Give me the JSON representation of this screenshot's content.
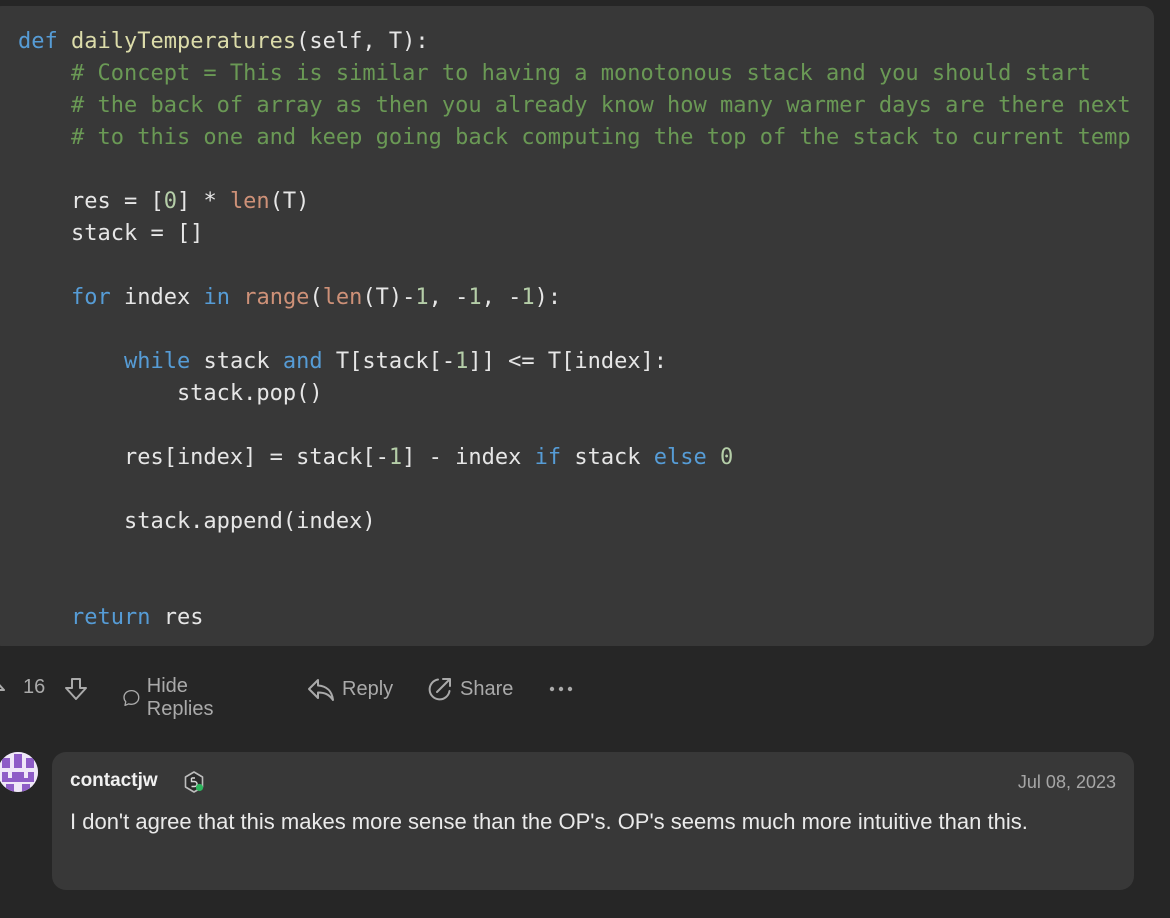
{
  "code": {
    "lines": [
      [
        {
          "t": "def ",
          "c": "kw"
        },
        {
          "t": "dailyTemperatures",
          "c": "fn"
        },
        {
          "t": "(self, T):",
          "c": ""
        }
      ],
      [
        {
          "t": "    # Concept = This is similar to having a monotonous stack and you should start",
          "c": "cm"
        }
      ],
      [
        {
          "t": "    # the back of array as then you already know how many warmer days are there next",
          "c": "cm"
        }
      ],
      [
        {
          "t": "    # to this one and keep going back computing the top of the stack to current temp",
          "c": "cm"
        }
      ],
      [
        {
          "t": "",
          "c": ""
        }
      ],
      [
        {
          "t": "    res = [",
          "c": ""
        },
        {
          "t": "0",
          "c": "nm"
        },
        {
          "t": "] * ",
          "c": ""
        },
        {
          "t": "len",
          "c": "bi"
        },
        {
          "t": "(T)",
          "c": ""
        }
      ],
      [
        {
          "t": "    stack = []",
          "c": ""
        }
      ],
      [
        {
          "t": "",
          "c": ""
        }
      ],
      [
        {
          "t": "    ",
          "c": ""
        },
        {
          "t": "for",
          "c": "kw"
        },
        {
          "t": " index ",
          "c": ""
        },
        {
          "t": "in",
          "c": "kw"
        },
        {
          "t": " ",
          "c": ""
        },
        {
          "t": "range",
          "c": "bi"
        },
        {
          "t": "(",
          "c": ""
        },
        {
          "t": "len",
          "c": "bi"
        },
        {
          "t": "(T)-",
          "c": ""
        },
        {
          "t": "1",
          "c": "nm"
        },
        {
          "t": ", -",
          "c": ""
        },
        {
          "t": "1",
          "c": "nm"
        },
        {
          "t": ", -",
          "c": ""
        },
        {
          "t": "1",
          "c": "nm"
        },
        {
          "t": "):",
          "c": ""
        }
      ],
      [
        {
          "t": "",
          "c": ""
        }
      ],
      [
        {
          "t": "        ",
          "c": ""
        },
        {
          "t": "while",
          "c": "kw"
        },
        {
          "t": " stack ",
          "c": ""
        },
        {
          "t": "and",
          "c": "kw"
        },
        {
          "t": " T[stack[-",
          "c": ""
        },
        {
          "t": "1",
          "c": "nm"
        },
        {
          "t": "]] <= T[index]:",
          "c": ""
        }
      ],
      [
        {
          "t": "            stack.pop()",
          "c": ""
        }
      ],
      [
        {
          "t": "",
          "c": ""
        }
      ],
      [
        {
          "t": "        res[index] = stack[-",
          "c": ""
        },
        {
          "t": "1",
          "c": "nm"
        },
        {
          "t": "] - index ",
          "c": ""
        },
        {
          "t": "if",
          "c": "kw"
        },
        {
          "t": " stack ",
          "c": ""
        },
        {
          "t": "else",
          "c": "kw"
        },
        {
          "t": " ",
          "c": ""
        },
        {
          "t": "0",
          "c": "nm"
        }
      ],
      [
        {
          "t": "",
          "c": ""
        }
      ],
      [
        {
          "t": "        stack.append(index)",
          "c": ""
        }
      ],
      [
        {
          "t": "",
          "c": ""
        }
      ],
      [
        {
          "t": "",
          "c": ""
        }
      ],
      [
        {
          "t": "    ",
          "c": ""
        },
        {
          "t": "return",
          "c": "kw"
        },
        {
          "t": " res",
          "c": ""
        }
      ]
    ]
  },
  "actions": {
    "upvote_icon": "upvote-icon",
    "vote_count": "16",
    "downvote_icon": "downvote-icon",
    "hide_replies_label": "Hide Replies",
    "reply_label": "Reply",
    "share_label": "Share",
    "more_icon": "more-icon"
  },
  "reply": {
    "author": "contactjw",
    "date": "Jul 08, 2023",
    "text": "I don't agree that this makes more sense than the OP's. OP's seems much more intuitive than this.",
    "badge_icon": "badge-icon",
    "avatar_color": "#8e5cc7"
  },
  "colors": {
    "background": "#262626",
    "card": "#383838",
    "keyword": "#569cd6",
    "function": "#dcdcaa",
    "comment": "#6a9955",
    "number": "#b5cea8",
    "builtin": "#ce9178"
  }
}
